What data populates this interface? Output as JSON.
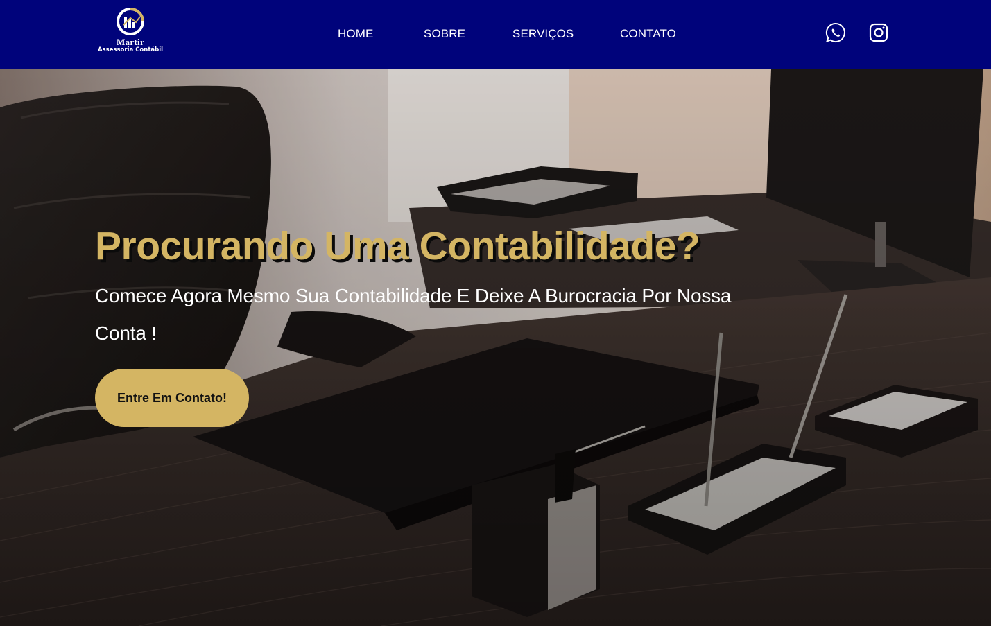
{
  "brand": {
    "name": "Martir",
    "tagline": "Assessoria Contábil"
  },
  "nav": {
    "items": [
      {
        "label": "HOME"
      },
      {
        "label": "SOBRE"
      },
      {
        "label": "SERVIÇOS"
      },
      {
        "label": "CONTATO"
      }
    ]
  },
  "social": {
    "icons": [
      "whatsapp-icon",
      "instagram-icon"
    ]
  },
  "hero": {
    "title": "Procurando Uma Contabilidade?",
    "subtitle": "Comece Agora Mesmo Sua Contabilidade E Deixe A Burocracia Por Nossa Conta !",
    "cta_label": "Entre Em Contato!"
  },
  "colors": {
    "header_bg": "#00037b",
    "accent_gold": "#d4b563",
    "text_light": "#ffffff"
  }
}
